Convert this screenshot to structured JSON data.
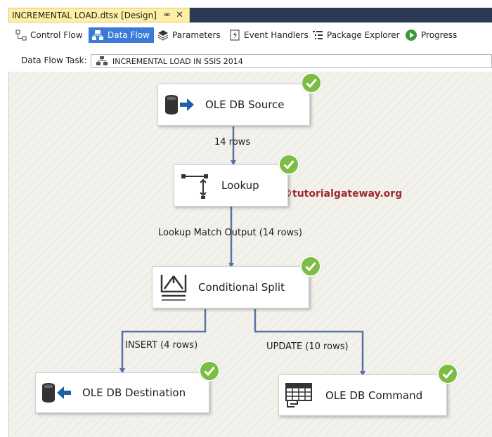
{
  "document_tab": {
    "title": "INCREMENTAL LOAD.dtsx [Design]",
    "pin_icon": "pin-icon",
    "close_icon": "close-icon"
  },
  "toolbar": {
    "tabs": [
      {
        "label": "Control Flow",
        "icon": "control-flow-icon",
        "active": false
      },
      {
        "label": "Data Flow",
        "icon": "data-flow-icon",
        "active": true
      },
      {
        "label": "Parameters",
        "icon": "parameters-icon",
        "active": false
      },
      {
        "label": "Event Handlers",
        "icon": "event-handlers-icon",
        "active": false
      },
      {
        "label": "Package Explorer",
        "icon": "package-explorer-icon",
        "active": false
      },
      {
        "label": "Progress",
        "icon": "progress-icon",
        "active": false
      }
    ],
    "active_color": "#3a7bd5"
  },
  "task": {
    "label": "Data Flow Task:",
    "value": "INCREMENTAL LOAD IN SSIS 2014",
    "icon": "data-flow-task-icon"
  },
  "canvas": {
    "watermark": "©tutorialgateway.org",
    "nodes": [
      {
        "label": "OLE DB Source",
        "icon": "database-source-icon",
        "status": "success"
      },
      {
        "label": "Lookup",
        "icon": "lookup-icon",
        "status": "success"
      },
      {
        "label": "Conditional Split",
        "icon": "conditional-split-icon",
        "status": "success"
      },
      {
        "label": "OLE DB Destination",
        "icon": "database-destination-icon",
        "status": "success"
      },
      {
        "label": "OLE DB Command",
        "icon": "command-icon",
        "status": "success"
      }
    ],
    "paths": [
      {
        "label": "14 rows"
      },
      {
        "label": "Lookup Match Output (14 rows)"
      },
      {
        "label": "INSERT (4 rows)"
      },
      {
        "label": "UPDATE (10 rows)"
      }
    ],
    "colors": {
      "success": "#7cbd43",
      "connector": "#5873a6",
      "watermark": "#a0282c"
    }
  }
}
